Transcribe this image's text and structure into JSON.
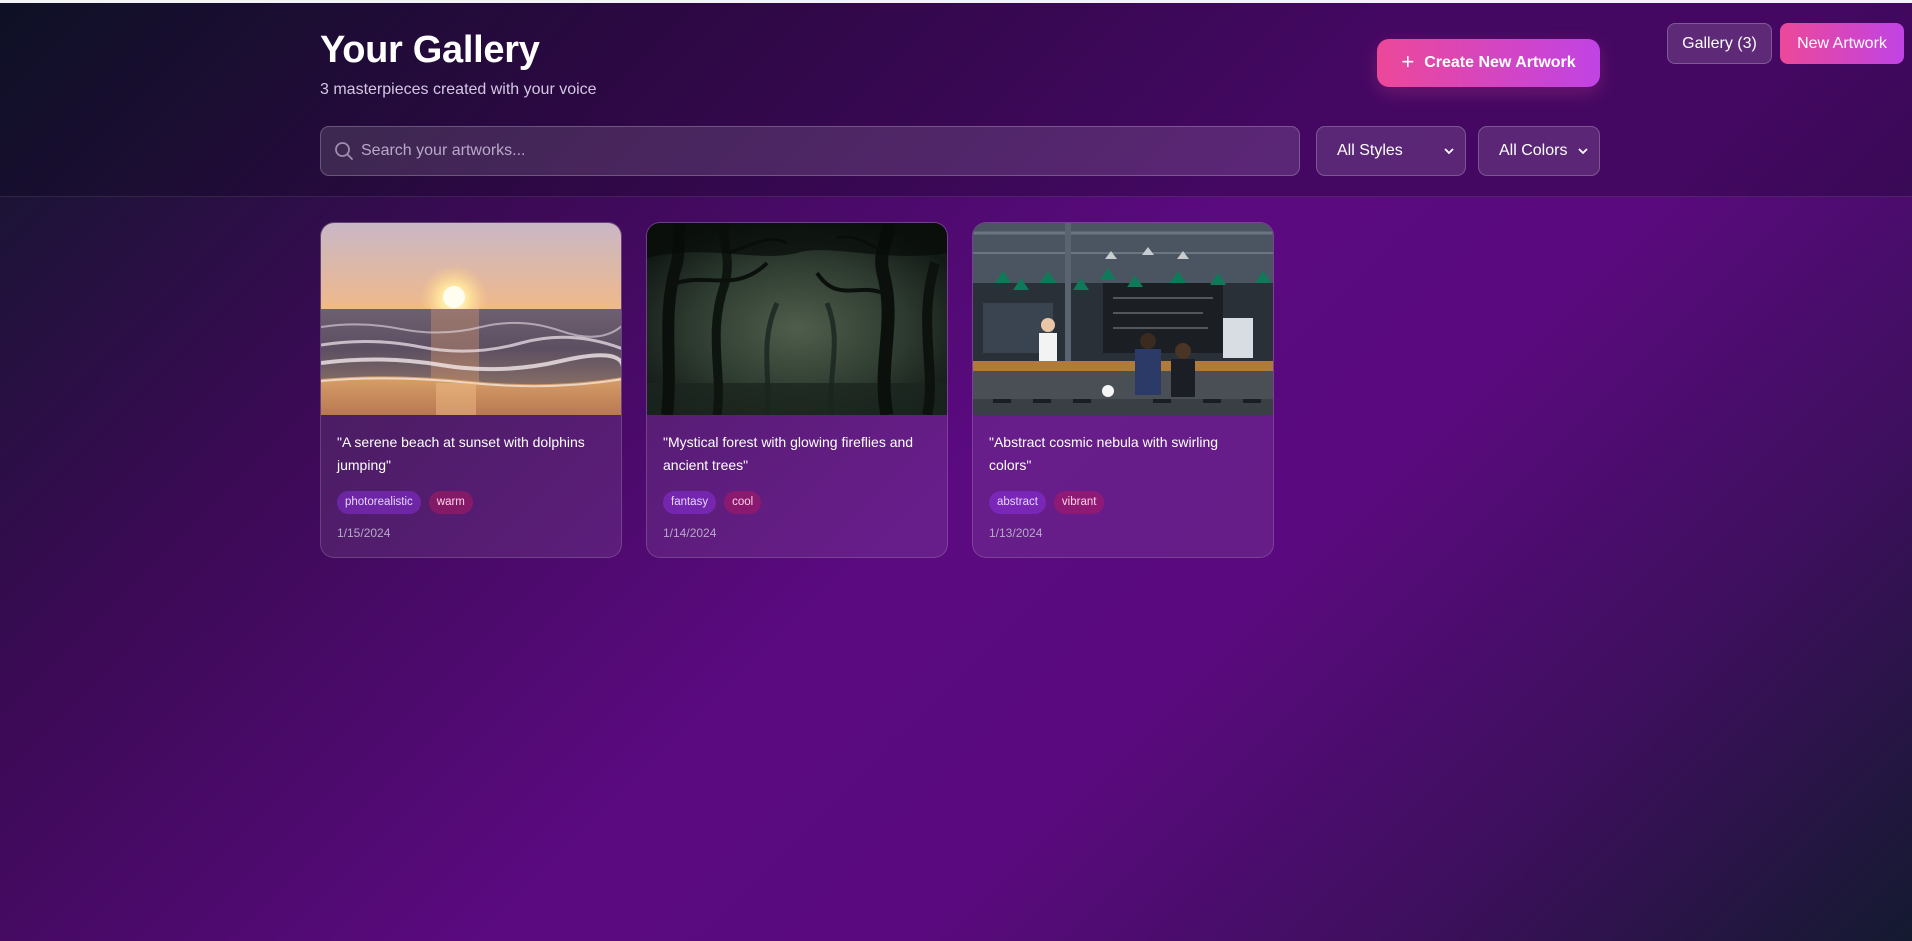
{
  "header": {
    "title": "Your Gallery",
    "subtitle": "3 masterpieces created with your voice",
    "create_button": "Create New Artwork"
  },
  "nav": {
    "gallery_label": "Gallery (3)",
    "new_artwork_label": "New Artwork"
  },
  "filters": {
    "search_placeholder": "Search your artworks...",
    "style_selected": "All Styles",
    "color_selected": "All Colors"
  },
  "artworks": [
    {
      "prompt": "\"A serene beach at sunset with dolphins jumping\"",
      "style": "photorealistic",
      "color": "warm",
      "date": "1/15/2024",
      "image": "beach-sunset-image"
    },
    {
      "prompt": "\"Mystical forest with glowing fireflies and ancient trees\"",
      "style": "fantasy",
      "color": "cool",
      "date": "1/14/2024",
      "image": "dark-forest-image"
    },
    {
      "prompt": "\"Abstract cosmic nebula with swirling colors\"",
      "style": "abstract",
      "color": "vibrant",
      "date": "1/13/2024",
      "image": "cafe-interior-image"
    }
  ],
  "colors": {
    "accent_gradient_start": "#ec4899",
    "accent_gradient_end": "#c043e4",
    "background_purple": "#5b0a80"
  }
}
